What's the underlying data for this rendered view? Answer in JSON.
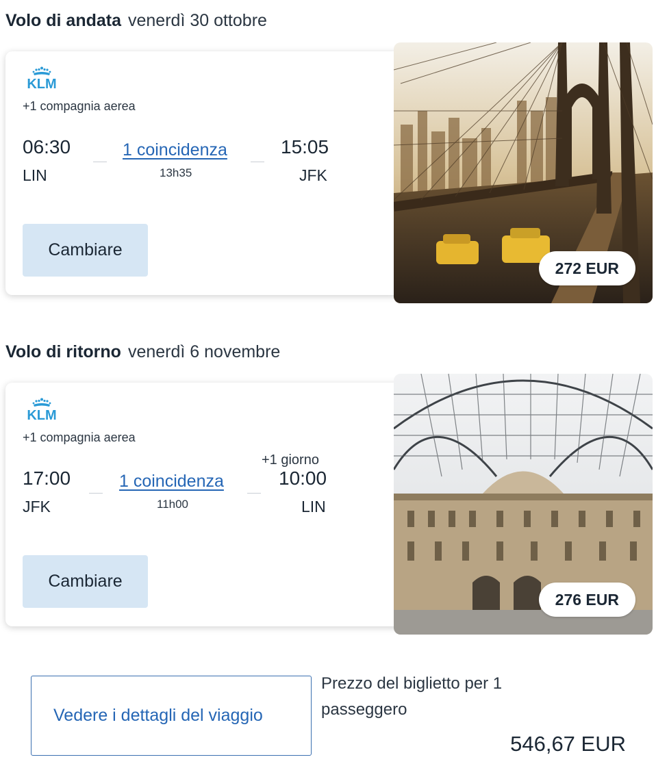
{
  "outbound": {
    "label": "Volo di andata",
    "date": "venerdì 30 ottobre",
    "airline": "KLM",
    "extra_airlines": "+1 compagnia aerea",
    "depart_time": "06:30",
    "depart_code": "LIN",
    "connection": "1 coincidenza",
    "duration": "13h35",
    "arrive_time": "15:05",
    "arrive_code": "JFK",
    "change_label": "Cambiare",
    "price": "272 EUR"
  },
  "return": {
    "label": "Volo di ritorno",
    "date": "venerdì 6 novembre",
    "airline": "KLM",
    "extra_airlines": "+1 compagnia aerea",
    "depart_time": "17:00",
    "depart_code": "JFK",
    "connection": "1 coincidenza",
    "duration": "11h00",
    "plus_day": "+1 giorno",
    "arrive_time": "10:00",
    "arrive_code": "LIN",
    "change_label": "Cambiare",
    "price": "276 EUR"
  },
  "footer": {
    "details_label": "Vedere i dettagli del viaggio",
    "price_label": "Prezzo del biglietto per 1 passeggero",
    "total": "546,67 EUR"
  },
  "colors": {
    "klm_blue": "#2a9ad6",
    "link": "#2566b5",
    "button_bg": "#d6e6f4",
    "text": "#1b2734"
  }
}
